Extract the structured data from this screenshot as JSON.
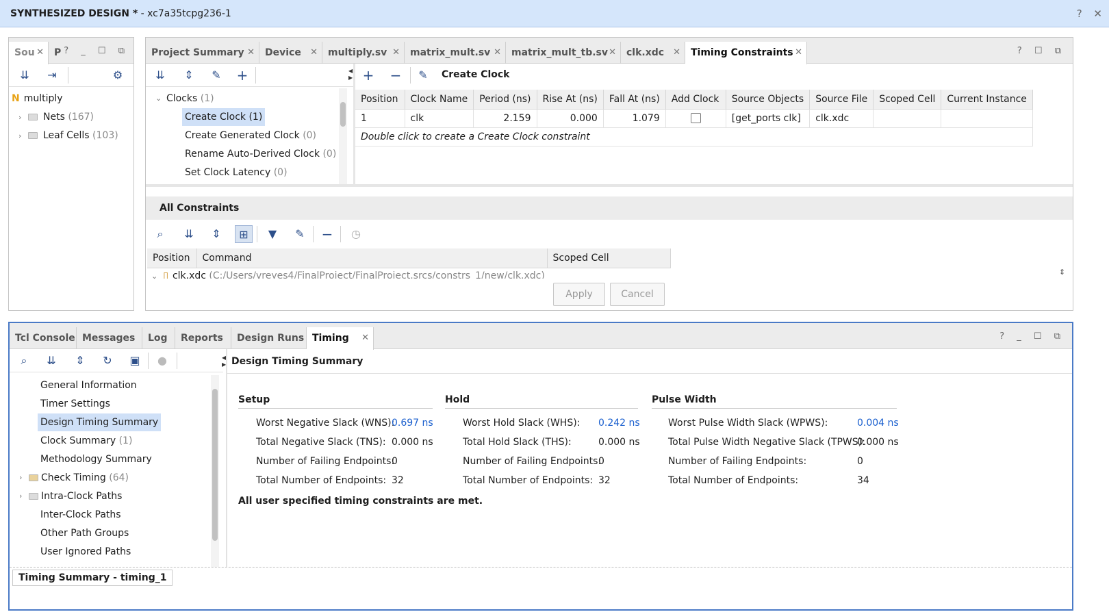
{
  "title": {
    "bold": "SYNTHESIZED DESIGN *",
    "rest": " - xc7a35tcpg236-1",
    "right_icons": "? ✕"
  },
  "sources": {
    "tabs": [
      {
        "label": "Sou",
        "close": "✕"
      },
      {
        "label": "P"
      }
    ],
    "window_icons": "? _ ☐ ⧉",
    "tree": {
      "root": "multiply",
      "root_icon": "N",
      "items": [
        {
          "label": "Nets",
          "count": "(167)"
        },
        {
          "label": "Leaf Cells",
          "count": "(103)"
        }
      ]
    }
  },
  "editor": {
    "tabs": [
      {
        "label": "Project Summary",
        "close": "✕"
      },
      {
        "label": "Device",
        "close": "✕"
      },
      {
        "label": "multiply.sv",
        "close": "✕"
      },
      {
        "label": "matrix_mult.sv",
        "close": "✕"
      },
      {
        "label": "matrix_mult_tb.sv",
        "close": "✕"
      },
      {
        "label": "clk.xdc",
        "close": "✕"
      },
      {
        "label": "Timing Constraints",
        "close": "✕"
      }
    ],
    "window_icons": "? ☐ ⧉",
    "constraint_tree": {
      "group": {
        "label": "Clocks",
        "count": "(1)"
      },
      "items": [
        {
          "label": "Create Clock",
          "count": "(1)"
        },
        {
          "label": "Create Generated Clock",
          "count": "(0)"
        },
        {
          "label": "Rename Auto-Derived Clock",
          "count": "(0)"
        },
        {
          "label": "Set Clock Latency",
          "count": "(0)"
        }
      ]
    },
    "detail_title": "Create Clock",
    "table": {
      "columns": [
        "Position",
        "Clock Name",
        "Period (ns)",
        "Rise At (ns)",
        "Fall At (ns)",
        "Add Clock",
        "Source Objects",
        "Source File",
        "Scoped Cell",
        "Current Instance"
      ],
      "rows": [
        {
          "position": "1",
          "name": "clk",
          "period": "2.159",
          "rise": "0.000",
          "fall": "1.079",
          "source_objects": "[get_ports clk]",
          "source_file": "clk.xdc",
          "scoped_cell": "",
          "current_instance": ""
        }
      ],
      "hint": "Double click to create a Create Clock constraint"
    },
    "all_constraints": {
      "title": "All Constraints",
      "columns": [
        "Position",
        "Command",
        "Scoped Cell"
      ],
      "row_file": "clk.xdc",
      "row_path": "(C:/Users/vreyes4/FinalProject/FinalProject.srcs/constrs_1/new/clk.xdc)"
    },
    "apply_label": "Apply",
    "cancel_label": "Cancel"
  },
  "bottom": {
    "tabs": [
      {
        "label": "Tcl Console"
      },
      {
        "label": "Messages"
      },
      {
        "label": "Log"
      },
      {
        "label": "Reports"
      },
      {
        "label": "Design Runs"
      },
      {
        "label": "Timing",
        "close": "✕"
      }
    ],
    "window_icons": "? _ ☐ ⧉",
    "nav": [
      {
        "label": "General Information",
        "count": ""
      },
      {
        "label": "Timer Settings",
        "count": ""
      },
      {
        "label": "Design Timing Summary",
        "count": ""
      },
      {
        "label": "Clock Summary",
        "count": "(1)"
      },
      {
        "label": "Methodology Summary",
        "count": ""
      },
      {
        "label": "Check Timing",
        "count": "(64)"
      },
      {
        "label": "Intra-Clock Paths",
        "count": ""
      },
      {
        "label": "Inter-Clock Paths",
        "count": ""
      },
      {
        "label": "Other Path Groups",
        "count": ""
      },
      {
        "label": "User Ignored Paths",
        "count": ""
      }
    ],
    "summary_title": "Design Timing Summary",
    "setup": {
      "title": "Setup",
      "rows": [
        {
          "label": "Worst Negative Slack (WNS):",
          "value": "0.697 ns"
        },
        {
          "label": "Total Negative Slack (TNS):",
          "value": "0.000 ns"
        },
        {
          "label": "Number of Failing Endpoints:",
          "value": "0"
        },
        {
          "label": "Total Number of Endpoints:",
          "value": "32"
        }
      ]
    },
    "hold": {
      "title": "Hold",
      "rows": [
        {
          "label": "Worst Hold Slack (WHS):",
          "value": "0.242 ns"
        },
        {
          "label": "Total Hold Slack (THS):",
          "value": "0.000 ns"
        },
        {
          "label": "Number of Failing Endpoints:",
          "value": "0"
        },
        {
          "label": "Total Number of Endpoints:",
          "value": "32"
        }
      ]
    },
    "pulse": {
      "title": "Pulse Width",
      "rows": [
        {
          "label": "Worst Pulse Width Slack (WPWS):",
          "value": "0.004 ns"
        },
        {
          "label": "Total Pulse Width Negative Slack (TPWS):",
          "value": "0.000 ns"
        },
        {
          "label": "Number of Failing Endpoints:",
          "value": "0"
        },
        {
          "label": "Total Number of Endpoints:",
          "value": "34"
        }
      ]
    },
    "status_msg": "All user specified timing constraints are met.",
    "footer_tab": "Timing Summary - timing_1"
  },
  "colors": {
    "accent": "#4a7ac6",
    "link": "#1a5fce",
    "selection": "#cfe0f7"
  }
}
